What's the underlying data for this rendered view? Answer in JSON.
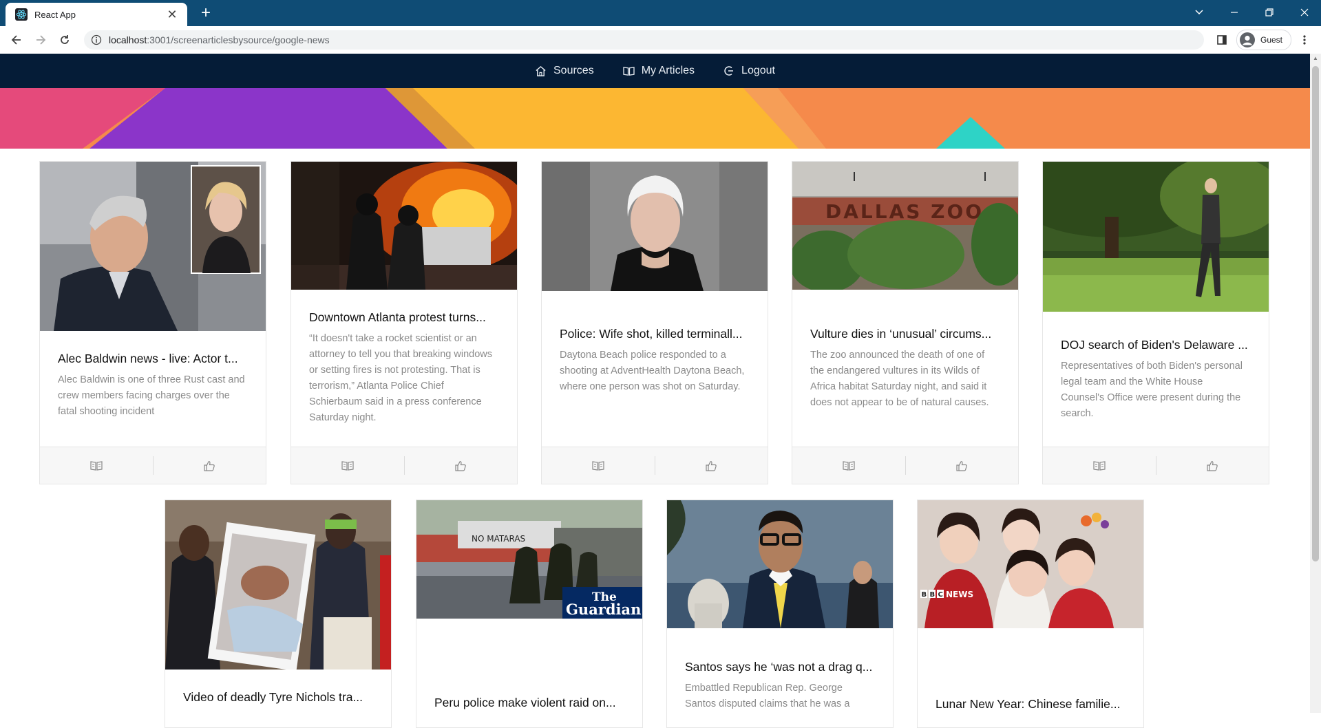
{
  "browser": {
    "tab_title": "React App",
    "url_host": "localhost",
    "url_rest": ":3001/screenarticlesbysource/google-news",
    "profile_label": "Guest"
  },
  "nav": {
    "items": [
      {
        "label": "Sources",
        "icon": "home-icon"
      },
      {
        "label": "My Articles",
        "icon": "book-icon"
      },
      {
        "label": "Logout",
        "icon": "logout-icon"
      }
    ]
  },
  "articles": [
    {
      "title": "Alec Baldwin news - live: Actor t...",
      "description": "Alec Baldwin is one of three Rust cast and crew members facing charges over the fatal shooting incident",
      "image": "portrait-photo"
    },
    {
      "title": "Downtown Atlanta protest turns...",
      "description": "“It doesn't take a rocket scientist or an attorney to tell you that breaking windows or setting fires is not protesting. That is terrorism,” Atlanta Police Chief Schierbaum said in a press conference Saturday night.",
      "image": "fire-photo"
    },
    {
      "title": "Police: Wife shot, killed terminall...",
      "description": "Daytona Beach police responded to a shooting at AdventHealth Daytona Beach, where one person was shot on Saturday.",
      "image": "mugshot-photo"
    },
    {
      "title": "Vulture dies in ‘unusual’ circums...",
      "description": "The zoo announced the death of one of the endangered vultures in its Wilds of Africa habitat Saturday night, and said it does not appear to be of natural causes.",
      "image": "zoo-photo",
      "sign_text": "DALLAS ZOO"
    },
    {
      "title": "DOJ search of Biden's Delaware ...",
      "description": "Representatives of both Biden's personal legal team and the White House Counsel's Office were present during the search.",
      "image": "park-photo"
    },
    {
      "title": "Video of deadly Tyre Nichols tra...",
      "description": "",
      "image": "hospital-photo"
    },
    {
      "title": "Peru police make violent raid on...",
      "description": "",
      "image": "riot-photo",
      "logo_line1": "The",
      "logo_line2": "Guardian"
    },
    {
      "title": "Santos says he ‘was not a drag q...",
      "description": "Embattled Republican Rep. George Santos disputed claims that he was a",
      "image": "capitol-photo"
    },
    {
      "title": "Lunar New Year: Chinese familie...",
      "description": "",
      "image": "group-photo",
      "logo_text": "NEWS",
      "logo_letters": [
        "B",
        "B",
        "C"
      ]
    }
  ],
  "footer_actions": {
    "left_icon": "read-icon",
    "right_icon": "thumbs-up-icon"
  },
  "colors": {
    "tabbar": "#0f4c75",
    "navbar": "#051c37",
    "banner_orange": "#f58a4b",
    "banner_purple": "#8b35c9",
    "banner_yellow": "#fcb732",
    "banner_pink": "#e54a7b",
    "banner_teal": "#2ed3c6"
  }
}
